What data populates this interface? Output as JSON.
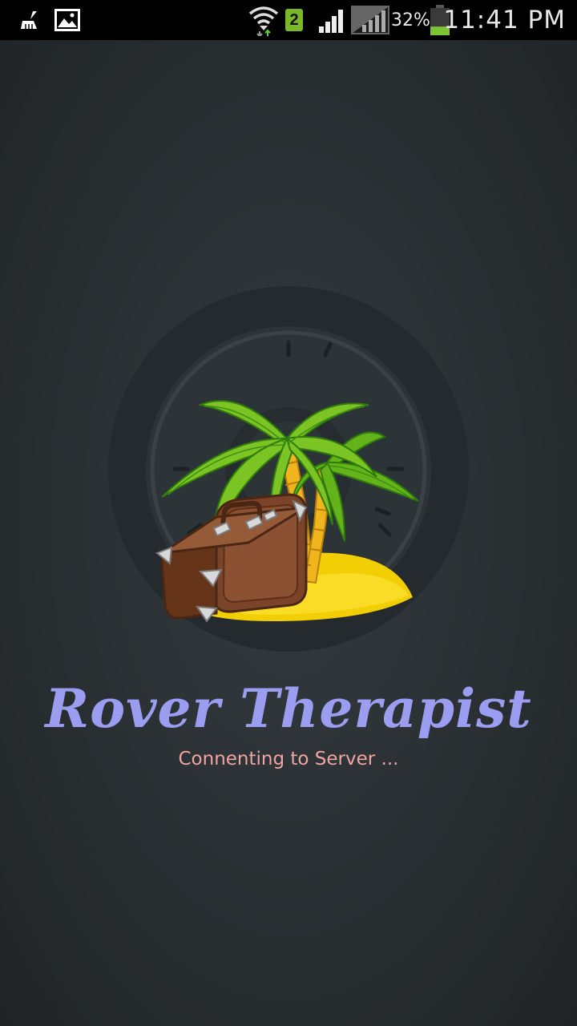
{
  "status_bar": {
    "battery_percent": "32%",
    "time": "11:41 PM",
    "sim_badge": "2",
    "battery_level": 0.32,
    "icons": [
      "cleaner-icon",
      "gallery-icon",
      "wifi-icon",
      "sim-2-icon",
      "signal-icon",
      "signal-2-icon",
      "battery-icon"
    ]
  },
  "splash": {
    "title": "Rover Therapist",
    "status": "Connenting to Server ...",
    "logo": "palm-island-suitcase-logo"
  },
  "colors": {
    "title": "#9a9df0",
    "status": "#f0a4a4",
    "background": "#2b3134"
  }
}
